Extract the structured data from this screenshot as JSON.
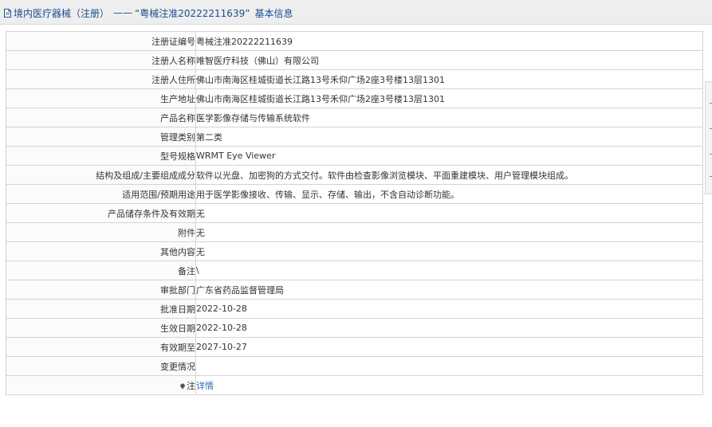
{
  "header": {
    "icon": "document-icon",
    "title": "境内医疗器械（注册）",
    "separator": "——",
    "registration_number": "“粤械注准20222211639”",
    "suffix": "基本信息"
  },
  "rows": [
    {
      "label": "注册证编号",
      "value": "粤械注准20222211639"
    },
    {
      "label": "注册人名称",
      "value": "唯智医疗科技（佛山）有限公司"
    },
    {
      "label": "注册人住所",
      "value": "佛山市南海区桂城街道长江路13号禾仰广场2座3号楼13层1301"
    },
    {
      "label": "生产地址",
      "value": "佛山市南海区桂城街道长江路13号禾仰广场2座3号楼13层1301"
    },
    {
      "label": "产品名称",
      "value": "医学影像存储与传输系统软件"
    },
    {
      "label": "管理类别",
      "value": "第二类"
    },
    {
      "label": "型号规格",
      "value": "WRMT Eye Viewer"
    },
    {
      "label": "结构及组成/主要组成成分",
      "value": "软件以光盘、加密狗的方式交付。软件由检查影像浏览模块、平面重建模块、用户管理模块组成。"
    },
    {
      "label": "适用范围/预期用途",
      "value": "用于医学影像接收、传输、显示、存储、输出，不含自动诊断功能。"
    },
    {
      "label": "产品储存条件及有效期",
      "value": "无"
    },
    {
      "label": "附件",
      "value": "无"
    },
    {
      "label": "其他内容",
      "value": "无"
    },
    {
      "label": "备注",
      "value": "\\"
    },
    {
      "label": "审批部门",
      "value": "广东省药品监督管理局"
    },
    {
      "label": "批准日期",
      "value": "2022-10-28"
    },
    {
      "label": "生效日期",
      "value": "2022-10-28"
    },
    {
      "label": "有效期至",
      "value": "2027-10-27"
    },
    {
      "label": "变更情况",
      "value": ""
    }
  ],
  "note_row": {
    "icon": "pin-icon",
    "label": "注",
    "link_text": "详情"
  },
  "colors": {
    "header_text": "#1a4d8f",
    "link": "#2a6ebb",
    "border": "#d4d4d4",
    "header_bg": "#eeeeee"
  }
}
